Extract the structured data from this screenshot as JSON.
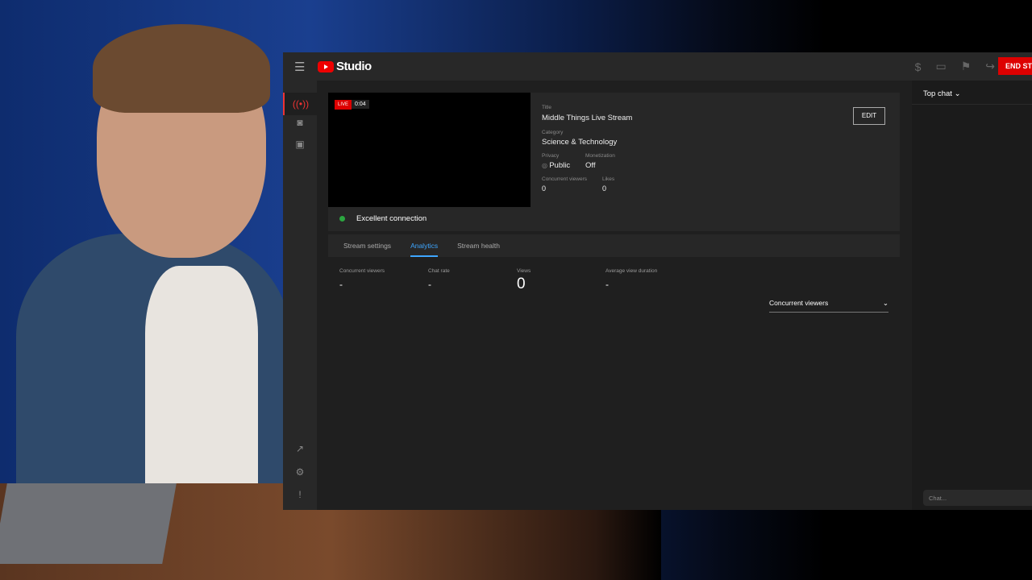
{
  "header": {
    "logo": "Studio",
    "end_stream": "END STREAM"
  },
  "preview": {
    "live_badge": "LIVE",
    "elapsed": "0:04",
    "connection": "Excellent connection"
  },
  "details": {
    "title_label": "Title",
    "title": "Middle Things Live Stream",
    "category_label": "Category",
    "category": "Science & Technology",
    "privacy_label": "Privacy",
    "privacy": "Public",
    "monetization_label": "Monetization",
    "monetization": "Off",
    "viewers_label": "Concurrent viewers",
    "viewers": "0",
    "likes_label": "Likes",
    "likes": "0",
    "edit": "EDIT"
  },
  "tabs": [
    "Stream settings",
    "Analytics",
    "Stream health"
  ],
  "metrics": [
    {
      "label": "Concurrent viewers",
      "value": "-"
    },
    {
      "label": "Chat rate",
      "value": "-"
    },
    {
      "label": "Views",
      "value": "0"
    },
    {
      "label": "Average view duration",
      "value": "-"
    }
  ],
  "chart_selector": "Concurrent viewers",
  "chat": {
    "header": "Top chat",
    "placeholder": "Chat..."
  }
}
